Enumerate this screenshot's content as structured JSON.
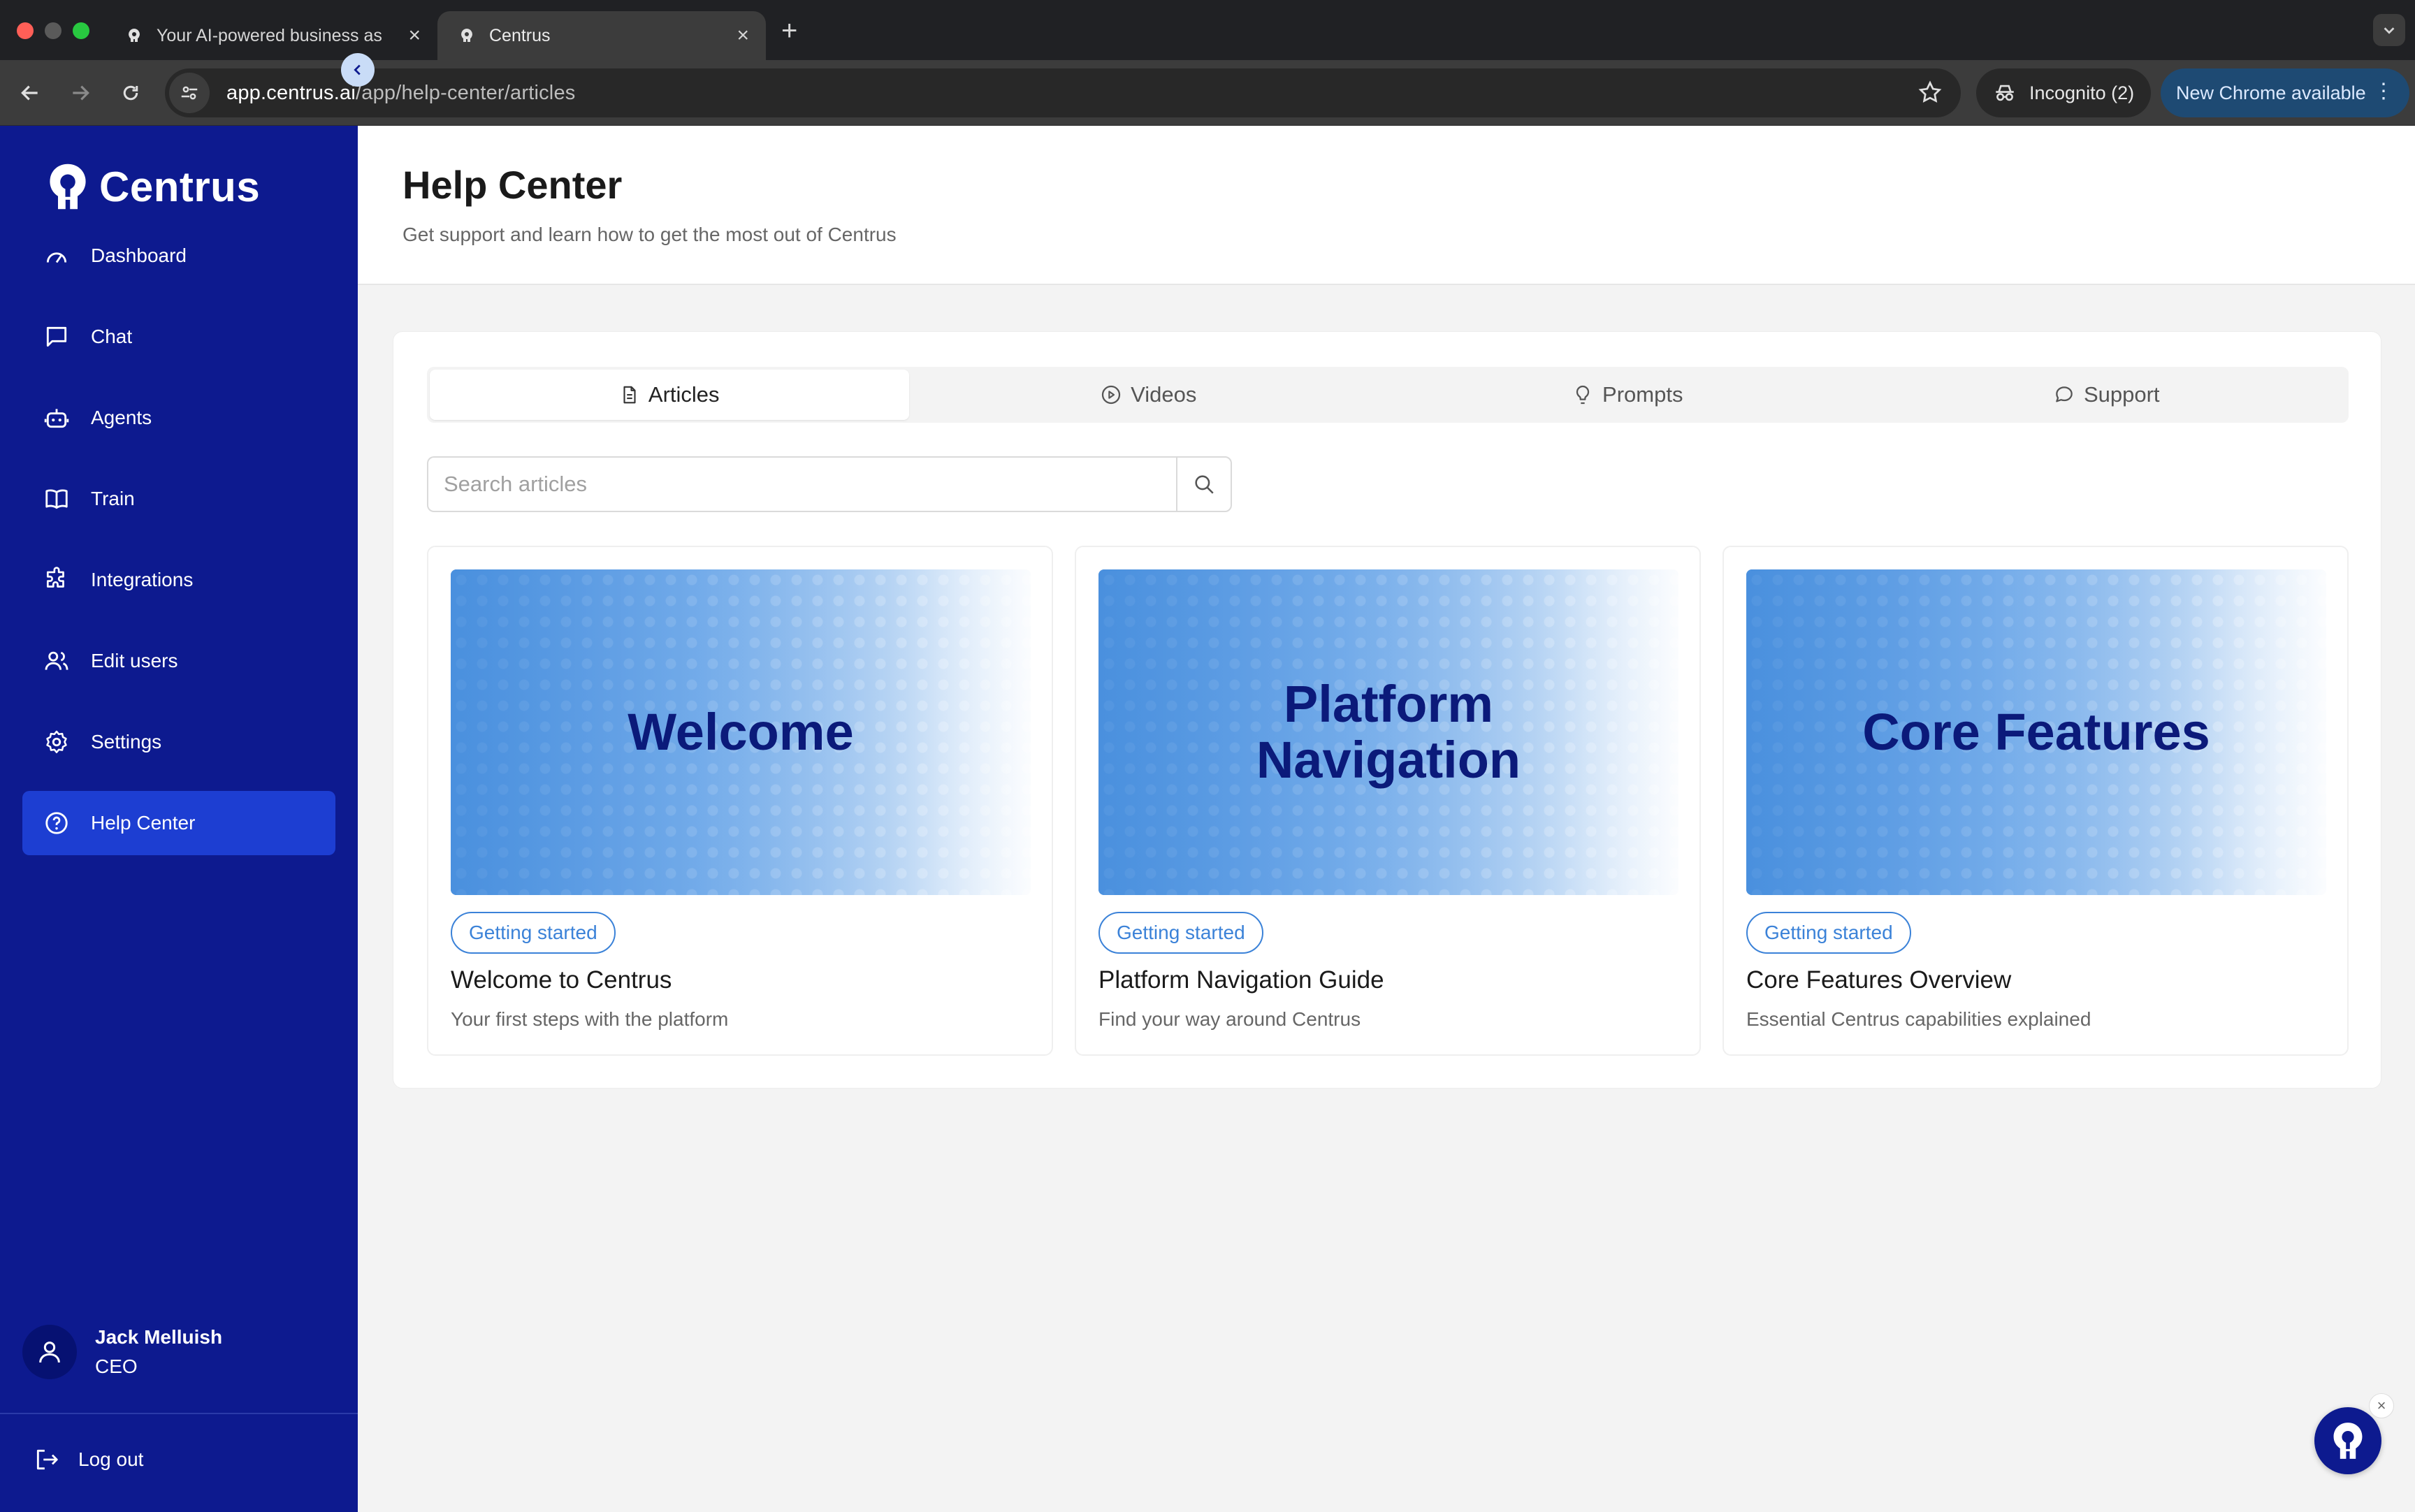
{
  "browser": {
    "tabs": [
      {
        "title": "Your AI-powered business as",
        "active": false
      },
      {
        "title": "Centrus",
        "active": true
      }
    ],
    "url_host": "app.centrus.ai",
    "url_path": "/app/help-center/articles",
    "incognito_label": "Incognito (2)",
    "update_label": "New Chrome available"
  },
  "sidebar": {
    "brand": "Centrus",
    "items": [
      {
        "label": "Dashboard",
        "icon": "gauge-icon"
      },
      {
        "label": "Chat",
        "icon": "chat-icon"
      },
      {
        "label": "Agents",
        "icon": "robot-icon"
      },
      {
        "label": "Train",
        "icon": "book-icon"
      },
      {
        "label": "Integrations",
        "icon": "puzzle-icon"
      },
      {
        "label": "Edit users",
        "icon": "users-icon"
      },
      {
        "label": "Settings",
        "icon": "gear-icon"
      },
      {
        "label": "Help Center",
        "icon": "help-circle-icon",
        "active": true
      }
    ],
    "user": {
      "name": "Jack Melluish",
      "role": "CEO"
    },
    "logout_label": "Log out"
  },
  "header": {
    "title": "Help Center",
    "subtitle": "Get support and learn how to get the most out of Centrus"
  },
  "tabs": [
    {
      "label": "Articles",
      "icon": "document-icon",
      "active": true
    },
    {
      "label": "Videos",
      "icon": "play-circle-icon"
    },
    {
      "label": "Prompts",
      "icon": "lightbulb-icon"
    },
    {
      "label": "Support",
      "icon": "chat-bubble-icon"
    }
  ],
  "search": {
    "placeholder": "Search articles"
  },
  "articles": [
    {
      "banner": "Welcome",
      "badge": "Getting started",
      "title": "Welcome to Centrus",
      "description": "Your first steps with the platform"
    },
    {
      "banner": "Platform Navigation",
      "badge": "Getting started",
      "title": "Platform Navigation Guide",
      "description": "Find your way around Centrus"
    },
    {
      "banner": "Core Features",
      "badge": "Getting started",
      "title": "Core Features Overview",
      "description": "Essential Centrus capabilities explained"
    }
  ],
  "colors": {
    "sidebar_bg": "#0d1a8f",
    "sidebar_active": "#1d3ed2",
    "badge": "#3b82d8",
    "banner_text": "#0b1a7a"
  }
}
